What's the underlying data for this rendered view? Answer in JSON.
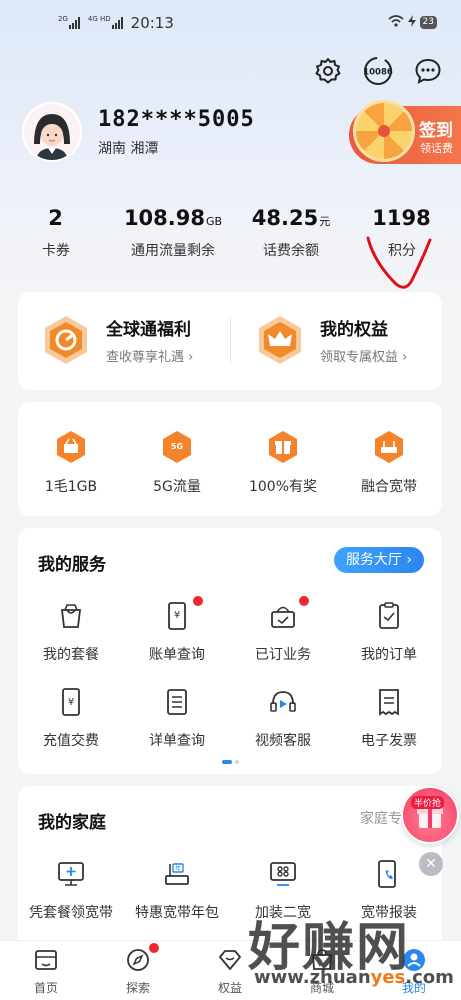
{
  "status_bar": {
    "signal1": "2G",
    "signal2": "4G HD",
    "time": "20:13",
    "battery": "23"
  },
  "header": {
    "phone": "182****5005",
    "region": "湖南  湘潭"
  },
  "signin": {
    "title": "签到",
    "subtitle": "领话费"
  },
  "top_icons": [
    "settings-icon",
    "10086-icon",
    "message-icon"
  ],
  "service_hotline": "10086",
  "stats": [
    {
      "value": "2",
      "unit": "",
      "label": "卡券"
    },
    {
      "value": "108.98",
      "unit": "GB",
      "label": "通用流量剩余"
    },
    {
      "value": "48.25",
      "unit": "元",
      "label": "话费余额"
    },
    {
      "value": "1198",
      "unit": "",
      "label": "积分"
    }
  ],
  "welfare": [
    {
      "title": "全球通福利",
      "subtitle": "查收尊享礼遇",
      "icon": "globe-badge-icon"
    },
    {
      "title": "我的权益",
      "subtitle": "领取专属权益",
      "icon": "crown-badge-icon"
    }
  ],
  "quick": [
    {
      "label": "1毛1GB",
      "icon": "basket-icon"
    },
    {
      "label": "5G流量",
      "icon": "5g-icon"
    },
    {
      "label": "100%有奖",
      "icon": "gift-icon"
    },
    {
      "label": "融合宽带",
      "icon": "router-icon"
    }
  ],
  "my_services": {
    "title": "我的服务",
    "hall_button": "服务大厅",
    "items": [
      {
        "label": "我的套餐",
        "icon": "bag-icon",
        "dot": false
      },
      {
        "label": "账单查询",
        "icon": "bill-icon",
        "dot": true
      },
      {
        "label": "已订业务",
        "icon": "subscribed-icon",
        "dot": true
      },
      {
        "label": "我的订单",
        "icon": "order-icon",
        "dot": false
      },
      {
        "label": "充值交费",
        "icon": "recharge-icon",
        "dot": false
      },
      {
        "label": "详单查询",
        "icon": "detail-list-icon",
        "dot": false
      },
      {
        "label": "视频客服",
        "icon": "video-support-icon",
        "dot": false
      },
      {
        "label": "电子发票",
        "icon": "invoice-icon",
        "dot": false
      }
    ]
  },
  "my_family": {
    "title": "我的家庭",
    "link": "家庭专",
    "items": [
      {
        "label": "凭套餐领宽带",
        "icon": "monitor-plus-icon"
      },
      {
        "label": "特惠宽带年包",
        "icon": "router-year-icon"
      },
      {
        "label": "加装二宽",
        "icon": "tv-box-icon"
      },
      {
        "label": "宽带报装",
        "icon": "phone-install-icon"
      }
    ]
  },
  "promo": {
    "tag": "半价抢"
  },
  "tabbar": [
    {
      "label": "首页",
      "icon": "home-icon",
      "dot": false
    },
    {
      "label": "探索",
      "icon": "compass-icon",
      "dot": true
    },
    {
      "label": "权益",
      "icon": "diamond-icon",
      "dot": false
    },
    {
      "label": "商城",
      "icon": "shop-icon",
      "dot": false
    },
    {
      "label": "我的",
      "icon": "profile-icon",
      "dot": false
    }
  ],
  "watermark": {
    "big": "好赚网",
    "small_prefix": "www.zhuan",
    "small_accent": "yes",
    "small_suffix": ".com"
  },
  "colors": {
    "accent_blue": "#2a86f0",
    "signin_red": "#e85a3c",
    "badge_orange": "#f08a2a",
    "dot_red": "#f0262c",
    "annotation_red": "#e0101a"
  }
}
